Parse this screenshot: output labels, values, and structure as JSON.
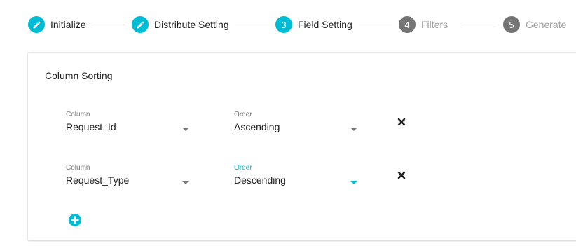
{
  "stepper": {
    "steps": [
      {
        "label": "Initialize",
        "marker": "pencil-icon",
        "state": "done"
      },
      {
        "label": "Distribute Setting",
        "marker": "pencil-icon",
        "state": "done"
      },
      {
        "label": "Field Setting",
        "number": "3",
        "state": "active"
      },
      {
        "label": "Filters",
        "number": "4",
        "state": "todo"
      },
      {
        "label": "Generate",
        "number": "5",
        "state": "todo"
      }
    ]
  },
  "card": {
    "title": "Column Sorting",
    "rows": [
      {
        "column_label": "Column",
        "column_value": "Request_Id",
        "order_label": "Order",
        "order_value": "Ascending"
      },
      {
        "column_label": "Column",
        "column_value": "Request_Type",
        "order_label": "Order",
        "order_value": "Descending"
      }
    ],
    "add_icon": "plus-circle-icon",
    "remove_icon": "close-icon"
  },
  "colors": {
    "accent": "#00bcd4",
    "inactive_step": "#757575",
    "muted_text": "#9e9e9e"
  }
}
